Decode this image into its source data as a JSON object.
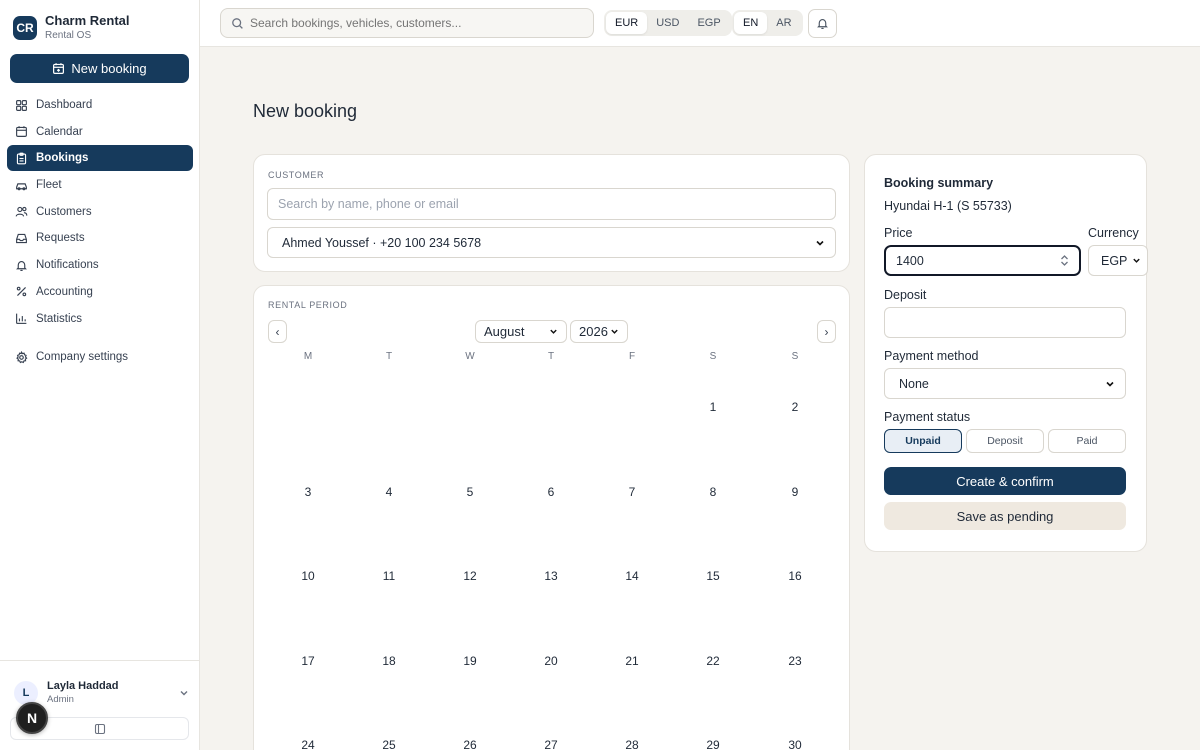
{
  "brand": {
    "logo": "CR",
    "name": "Charm Rental",
    "subtitle": "Rental OS"
  },
  "sidebar": {
    "new_booking_label": "New booking",
    "items": [
      {
        "label": "Dashboard",
        "icon": "grid-icon",
        "active": false
      },
      {
        "label": "Calendar",
        "icon": "calendar-icon",
        "active": false
      },
      {
        "label": "Bookings",
        "icon": "clipboard-icon",
        "active": true
      },
      {
        "label": "Fleet",
        "icon": "car-icon",
        "active": false
      },
      {
        "label": "Customers",
        "icon": "users-icon",
        "active": false
      },
      {
        "label": "Requests",
        "icon": "inbox-icon",
        "active": false
      },
      {
        "label": "Notifications",
        "icon": "bell-icon",
        "active": false
      },
      {
        "label": "Accounting",
        "icon": "percent-icon",
        "active": false
      },
      {
        "label": "Statistics",
        "icon": "bar-chart-icon",
        "active": false
      }
    ],
    "settings_label": "Company settings",
    "user": {
      "initial": "L",
      "name": "Layla Haddad",
      "role": "Admin"
    },
    "badge": "N"
  },
  "topbar": {
    "search_placeholder": "Search bookings, vehicles, customers...",
    "currencies": [
      "EUR",
      "USD",
      "EGP"
    ],
    "active_currency": "EUR",
    "languages": [
      "EN",
      "AR"
    ],
    "active_language": "EN"
  },
  "page": {
    "title": "New booking"
  },
  "customer": {
    "section_label": "CUSTOMER",
    "search_placeholder": "Search by name, phone or email",
    "selected": "Ahmed Youssef · +20 100 234 5678"
  },
  "rental_period": {
    "section_label": "RENTAL PERIOD",
    "month": "August",
    "year": "2026",
    "prev": "‹",
    "next": "›",
    "weekdays": [
      "M",
      "T",
      "W",
      "T",
      "F",
      "S",
      "S"
    ],
    "weeks": [
      [
        "",
        "",
        "",
        "",
        "",
        "1",
        "2"
      ],
      [
        "3",
        "4",
        "5",
        "6",
        "7",
        "8",
        "9"
      ],
      [
        "10",
        "11",
        "12",
        "13",
        "14",
        "15",
        "16"
      ],
      [
        "17",
        "18",
        "19",
        "20",
        "21",
        "22",
        "23"
      ],
      [
        "24",
        "25",
        "26",
        "27",
        "28",
        "29",
        "30"
      ]
    ]
  },
  "summary": {
    "title": "Booking summary",
    "vehicle": "Hyundai H-1 (S 55733)",
    "price_label": "Price",
    "price_value": "1400",
    "currency_label": "Currency",
    "currency_value": "EGP",
    "deposit_label": "Deposit",
    "deposit_value": "",
    "payment_method_label": "Payment method",
    "payment_method_value": "None",
    "payment_status_label": "Payment status",
    "payment_statuses": [
      "Unpaid",
      "Deposit",
      "Paid"
    ],
    "active_payment_status": "Unpaid",
    "create_label": "Create & confirm",
    "pending_label": "Save as pending"
  },
  "colors": {
    "primary": "#163a5c",
    "background": "#f5f3ef",
    "secondary_button": "#efe9e0"
  }
}
